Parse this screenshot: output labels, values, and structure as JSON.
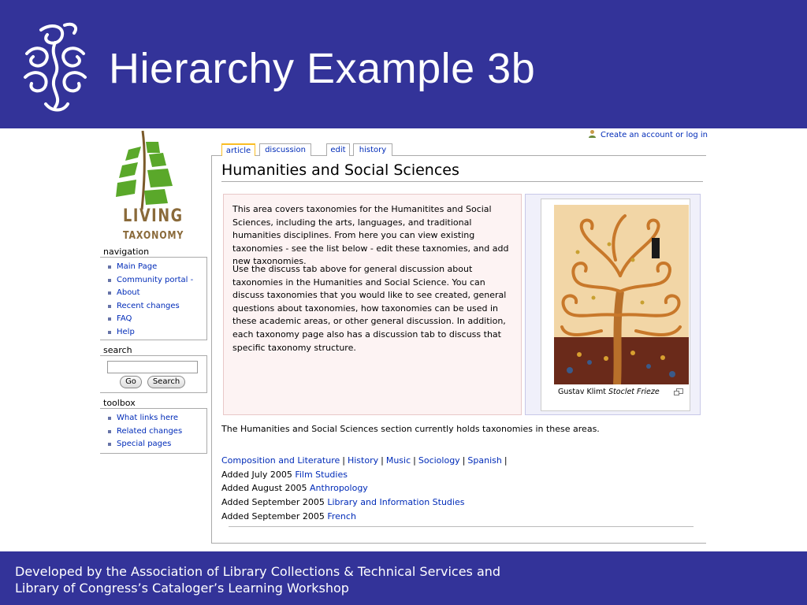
{
  "slide": {
    "title": "Hierarchy Example 3b",
    "footer_line1": "Developed by the Association of Library Collections & Technical Services and",
    "footer_line2": "Library of Congress’s Cataloger’s Learning Workshop",
    "header_color": "#333399"
  },
  "logo": {
    "line1": "LIVING",
    "line2": "TAXONOMY"
  },
  "sidebar": {
    "navigation_title": "navigation",
    "navigation_items": [
      {
        "label": "Main Page"
      },
      {
        "label": "Community portal -"
      },
      {
        "label": "About"
      },
      {
        "label": "Recent changes"
      },
      {
        "label": "FAQ"
      },
      {
        "label": "Help"
      }
    ],
    "search_title": "search",
    "search_value": "",
    "go_label": "Go",
    "search_label": "Search",
    "toolbox_title": "toolbox",
    "toolbox_items": [
      {
        "label": "What links here"
      },
      {
        "label": "Related changes"
      },
      {
        "label": "Special pages"
      }
    ]
  },
  "tabs": [
    {
      "label": "article",
      "active": true
    },
    {
      "label": "discussion",
      "active": false
    },
    {
      "label": "edit",
      "active": false
    },
    {
      "label": "history",
      "active": false
    }
  ],
  "personal": {
    "login_label": "Create an account or log in"
  },
  "article": {
    "heading": "Humanities and Social Sciences",
    "paragraph1": "This area covers taxonomies for the Humanitites and Social Sciences, including the arts, languages, and traditional humanities disciplines. From here you can view existing taxonomies - see the list below - edit these taxnomies, and add new taxonomies.",
    "paragraph2": "Use the discuss tab above for general discussion about taxonomies in the Humanities and Social Science. You can discuss taxonomies that you would like to see created, general questions about taxonomies, how taxonomies can be used in these academic areas, or other general discussion. In addition, each taxonomy page also has a discussion tab to discuss that specific taxonomy structure.",
    "image_caption_plain": "Gustav Klimt ",
    "image_caption_italic": "Stoclet Frieze",
    "summary": "The Humanities and Social Sciences section currently holds taxonomies in these areas.",
    "categories": [
      {
        "label": "Composition and Literature"
      },
      {
        "label": "History"
      },
      {
        "label": "Music"
      },
      {
        "label": "Sociology"
      },
      {
        "label": "Spanish"
      }
    ],
    "separator": "|",
    "additions": [
      {
        "prefix": "Added July 2005 ",
        "link": "Film Studies"
      },
      {
        "prefix": "Added August 2005 ",
        "link": "Anthropology"
      },
      {
        "prefix": "Added September 2005 ",
        "link": "Library and Information Studies"
      },
      {
        "prefix": "Added September 2005 ",
        "link": "French"
      }
    ]
  },
  "colors": {
    "link": "#002bb8",
    "logo_green": "#5aa82a",
    "logo_brown": "#8a6a3a",
    "intro_bg": "#fdf3f3"
  }
}
